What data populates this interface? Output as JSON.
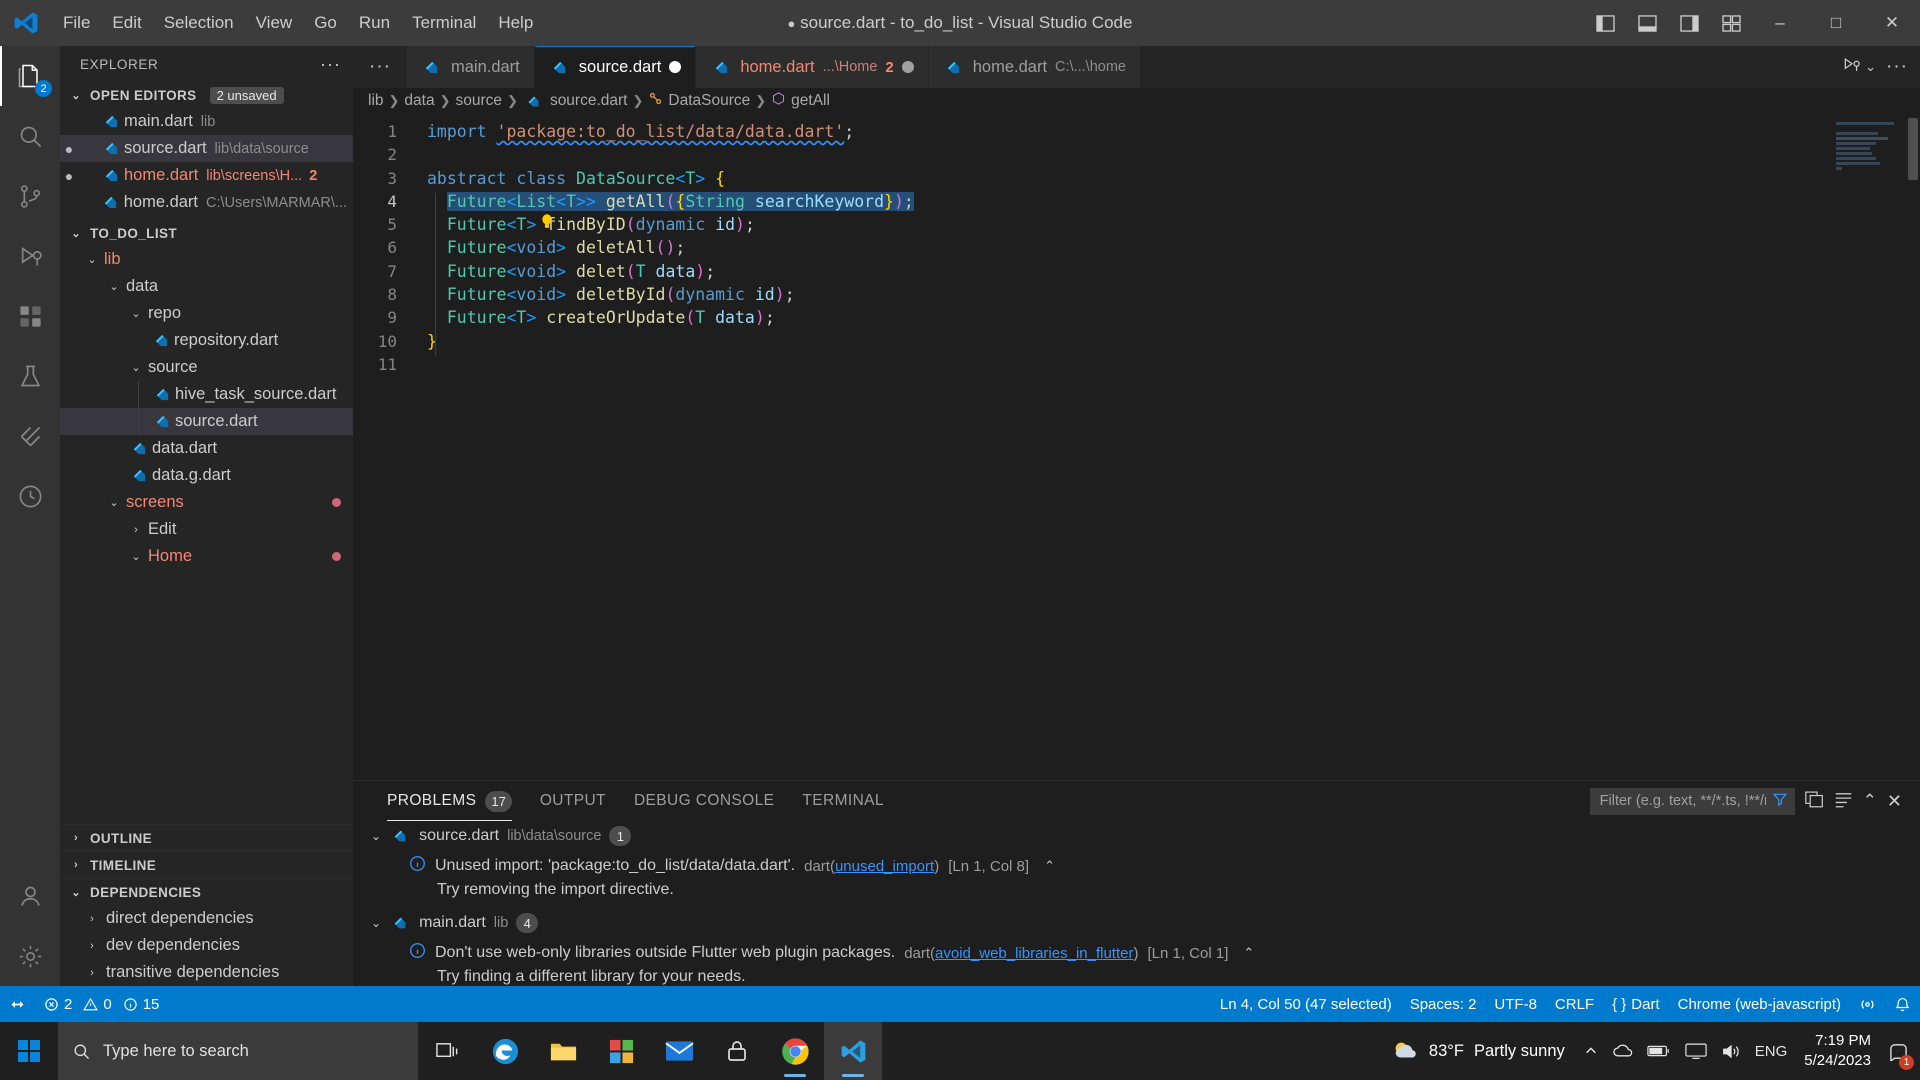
{
  "titlebar": {
    "menus": [
      "File",
      "Edit",
      "Selection",
      "View",
      "Go",
      "Run",
      "Terminal",
      "Help"
    ],
    "title": "source.dart - to_do_list - Visual Studio Code",
    "unsaved_dot": "●",
    "minimize": "–",
    "maximize": "□",
    "close": "✕"
  },
  "activitybar": {
    "explorer_badge": "2",
    "items": [
      {
        "name": "explorer",
        "icon": "files-icon"
      },
      {
        "name": "search",
        "icon": "search-icon"
      },
      {
        "name": "source-control",
        "icon": "source-control-icon"
      },
      {
        "name": "run-and-debug",
        "icon": "debug-icon"
      },
      {
        "name": "extensions",
        "icon": "extensions-icon"
      },
      {
        "name": "testing",
        "icon": "beaker-icon"
      },
      {
        "name": "flutter",
        "icon": "flutter-icon"
      },
      {
        "name": "dependency-analysis",
        "icon": "clock-icon"
      }
    ],
    "bottom": [
      {
        "name": "accounts",
        "icon": "account-icon"
      },
      {
        "name": "manage",
        "icon": "gear-icon"
      }
    ]
  },
  "sidebar": {
    "header": "EXPLORER",
    "open_editors": {
      "title": "OPEN EDITORS",
      "badge": "2 unsaved",
      "items": [
        {
          "name": "main.dart",
          "path": "lib",
          "dirty": false,
          "error": false,
          "selected": false
        },
        {
          "name": "source.dart",
          "path": "lib\\data\\source",
          "dirty": true,
          "error": false,
          "selected": true
        },
        {
          "name": "home.dart",
          "path": "lib\\screens\\H...",
          "dirty": true,
          "error": true,
          "selected": false,
          "err_count": "2"
        },
        {
          "name": "home.dart",
          "path": "C:\\Users\\MARMAR\\...",
          "dirty": false,
          "error": false,
          "selected": false
        }
      ]
    },
    "project": {
      "title": "TO_DO_LIST",
      "tree": [
        {
          "label": "lib",
          "type": "folder",
          "depth": 1,
          "open": true,
          "error": true
        },
        {
          "label": "data",
          "type": "folder",
          "depth": 2,
          "open": true,
          "error": false
        },
        {
          "label": "repo",
          "type": "folder",
          "depth": 3,
          "open": true,
          "error": false
        },
        {
          "label": "repository.dart",
          "type": "file",
          "depth": 4,
          "error": false
        },
        {
          "label": "source",
          "type": "folder",
          "depth": 3,
          "open": true,
          "error": false
        },
        {
          "label": "hive_task_source.dart",
          "type": "file",
          "depth": 4,
          "error": false
        },
        {
          "label": "source.dart",
          "type": "file",
          "depth": 4,
          "error": false,
          "selected": true
        },
        {
          "label": "data.dart",
          "type": "file",
          "depth": 3,
          "error": false
        },
        {
          "label": "data.g.dart",
          "type": "file",
          "depth": 3,
          "error": false
        },
        {
          "label": "screens",
          "type": "folder",
          "depth": 2,
          "open": true,
          "error": true
        },
        {
          "label": "Edit",
          "type": "folder",
          "depth": 3,
          "open": false,
          "error": false
        },
        {
          "label": "Home",
          "type": "folder",
          "depth": 3,
          "open": true,
          "error": true
        }
      ]
    },
    "sections": [
      {
        "title": "OUTLINE",
        "open": false
      },
      {
        "title": "TIMELINE",
        "open": false
      },
      {
        "title": "DEPENDENCIES",
        "open": true
      }
    ],
    "dependencies": [
      {
        "label": "direct dependencies"
      },
      {
        "label": "dev dependencies"
      },
      {
        "label": "transitive dependencies"
      }
    ]
  },
  "tabs": [
    {
      "label": "main.dart",
      "sub": "",
      "active": false,
      "dirty": false,
      "error": false
    },
    {
      "label": "source.dart",
      "sub": "",
      "active": true,
      "dirty": true,
      "error": false
    },
    {
      "label": "home.dart",
      "sub": "...\\Home",
      "active": false,
      "dirty": true,
      "error": true,
      "err_count": "2"
    },
    {
      "label": "home.dart",
      "sub": "C:\\...\\home",
      "active": false,
      "dirty": false,
      "error": false
    }
  ],
  "tab_actions": {
    "more": "···",
    "run": "run-and-debug-icon",
    "chevron": "⌄"
  },
  "breadcrumb": [
    "lib",
    "data",
    "source",
    "source.dart",
    "DataSource",
    "getAll"
  ],
  "editor": {
    "line_numbers": [
      "1",
      "2",
      "3",
      "4",
      "5",
      "6",
      "7",
      "8",
      "9",
      "10",
      "11"
    ],
    "code": [
      "import 'package:to_do_list/data/data.dart';",
      "",
      "abstract class DataSource<T> {",
      "  Future<List<T>> getAll({String searchKeyword});",
      "  Future<T> findByID(dynamic id);",
      "  Future<void> deletAll();",
      "  Future<void> delet(T data);",
      "  Future<void> deletById(dynamic id);",
      "  Future<T> createOrUpdate(T data);",
      "}",
      ""
    ]
  },
  "panel": {
    "tabs": [
      {
        "label": "PROBLEMS",
        "count": "17",
        "active": true
      },
      {
        "label": "OUTPUT",
        "count": "",
        "active": false
      },
      {
        "label": "DEBUG CONSOLE",
        "count": "",
        "active": false
      },
      {
        "label": "TERMINAL",
        "count": "",
        "active": false
      }
    ],
    "filter_placeholder": "Filter (e.g. text, **/*.ts, !**/node_modules/**)",
    "filter_value": "",
    "actions": {
      "filter": "filter-icon",
      "split": "split-panel-icon",
      "clear": "clear-icon",
      "chevron_up": "chevron-up-icon",
      "close": "close-icon"
    },
    "problems": [
      {
        "file": "source.dart",
        "path": "lib\\data\\source",
        "count": "1",
        "items": [
          {
            "severity": "info",
            "message": "Unused import: 'package:to_do_list/data/data.dart'.",
            "code_prefix": "dart(",
            "code_link": "unused_import",
            "code_suffix": ")",
            "position": "[Ln 1, Col 8]",
            "sub": "Try removing the import directive."
          }
        ]
      },
      {
        "file": "main.dart",
        "path": "lib",
        "count": "4",
        "items": [
          {
            "severity": "info",
            "message": "Don't use web-only libraries outside Flutter web plugin packages.",
            "code_prefix": "dart(",
            "code_link": "avoid_web_libraries_in_flutter",
            "code_suffix": ")",
            "position": "[Ln 1, Col 1]",
            "sub": "Try finding a different library for your needs."
          }
        ]
      }
    ]
  },
  "statusbar": {
    "left": [
      {
        "name": "remote",
        "icon": "remote-icon",
        "label": ""
      },
      {
        "name": "errors",
        "label": "2",
        "icon": "error-icon"
      },
      {
        "name": "warnings",
        "label": "0",
        "icon": "warning-icon"
      },
      {
        "name": "infos",
        "label": "15",
        "icon": "info-icon"
      }
    ],
    "right": [
      {
        "name": "cursor-position",
        "label": "Ln 4, Col 50 (47 selected)"
      },
      {
        "name": "indentation",
        "label": "Spaces: 2"
      },
      {
        "name": "encoding",
        "label": "UTF-8"
      },
      {
        "name": "eol",
        "label": "CRLF"
      },
      {
        "name": "language-mode",
        "label": "Dart",
        "icon": "braces-icon"
      },
      {
        "name": "device-target",
        "label": "Chrome (web-javascript)"
      },
      {
        "name": "remote-indicator",
        "label": "",
        "icon": "broadcast-icon"
      },
      {
        "name": "notifications",
        "label": "",
        "icon": "bell-icon"
      }
    ]
  },
  "taskbar": {
    "search_placeholder": "Type here to search",
    "apps": [
      {
        "name": "task-view",
        "icon": "task-view-icon"
      },
      {
        "name": "edge",
        "icon": "edge-icon"
      },
      {
        "name": "file-explorer",
        "icon": "folder-icon"
      },
      {
        "name": "microsoft-store",
        "icon": "store-icon"
      },
      {
        "name": "mail",
        "icon": "mail-icon"
      },
      {
        "name": "security",
        "icon": "lock-icon"
      },
      {
        "name": "chrome",
        "icon": "chrome-icon"
      },
      {
        "name": "vscode",
        "icon": "vscode-icon"
      }
    ],
    "weather": {
      "temp": "83°F",
      "desc": "Partly sunny"
    },
    "tray": [
      "^",
      "onedrive-icon",
      "battery-icon",
      "display-icon",
      "volume-icon"
    ],
    "language": "ENG",
    "time": "7:19 PM",
    "date": "5/24/2023",
    "notification_count": "1"
  }
}
